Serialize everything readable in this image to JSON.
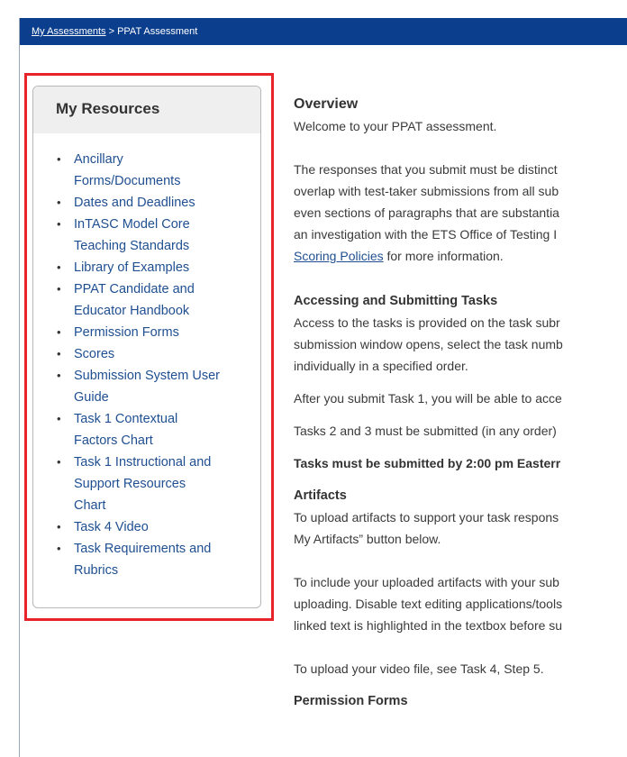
{
  "breadcrumb": {
    "link": "My Assessments",
    "separator": " > ",
    "current": "PPAT Assessment"
  },
  "resources": {
    "title": "My Resources",
    "items": [
      {
        "label": "Ancillary Forms/Documents",
        "lines": [
          "Ancillary",
          "Forms/Documents"
        ]
      },
      {
        "label": "Dates and Deadlines",
        "lines": [
          "Dates and Deadlines"
        ]
      },
      {
        "label": "InTASC Model Core Teaching Standards",
        "lines": [
          "InTASC Model Core",
          "Teaching Standards"
        ]
      },
      {
        "label": "Library of Examples",
        "lines": [
          "Library of Examples"
        ]
      },
      {
        "label": "PPAT Candidate and Educator Handbook",
        "lines": [
          "PPAT Candidate and",
          "Educator Handbook"
        ]
      },
      {
        "label": "Permission Forms",
        "lines": [
          "Permission Forms"
        ]
      },
      {
        "label": "Scores",
        "lines": [
          "Scores"
        ]
      },
      {
        "label": "Submission System User Guide",
        "lines": [
          "Submission System User",
          "Guide"
        ]
      },
      {
        "label": "Task 1 Contextual Factors Chart",
        "lines": [
          "Task 1 Contextual",
          "Factors Chart"
        ]
      },
      {
        "label": "Task 1 Instructional and Support Resources Chart",
        "lines": [
          "Task 1 Instructional and",
          "Support Resources",
          "Chart"
        ]
      },
      {
        "label": "Task 4 Video",
        "lines": [
          "Task 4 Video"
        ]
      },
      {
        "label": "Task Requirements and Rubrics",
        "lines": [
          "Task Requirements and",
          "Rubrics"
        ]
      }
    ]
  },
  "overview": {
    "heading": "Overview",
    "welcome": "Welcome to your PPAT assessment.",
    "para_lines": [
      "The responses that you submit must be distinct",
      "overlap with test-taker submissions from all sub",
      "even sections of paragraphs that are substantia",
      "an investigation with the ETS Office of Testing I"
    ],
    "scoring_link": "Scoring Policies",
    "scoring_suffix": " for more information."
  },
  "accessing": {
    "heading": "Accessing and Submitting Tasks",
    "para_lines": [
      "Access to the tasks is provided on the task subr",
      "submission window opens, select the task numb",
      "individually in a specified order."
    ],
    "after_task1": "After you submit Task 1, you will be able to acce",
    "tasks23": "Tasks 2 and 3 must be submitted (in any order)",
    "deadline": "Tasks must be submitted by 2:00 pm Easterr"
  },
  "artifacts": {
    "heading": "Artifacts",
    "para1_lines": [
      "To upload artifacts to support your task respons",
      "My Artifacts” button below."
    ],
    "para2_lines": [
      "To include your uploaded artifacts with your sub",
      "uploading. Disable text editing applications/tools",
      "linked text is highlighted in the textbox before su"
    ],
    "video": "To upload your video file, see Task 4, Step 5."
  },
  "cutoff_heading": "Permission Forms"
}
